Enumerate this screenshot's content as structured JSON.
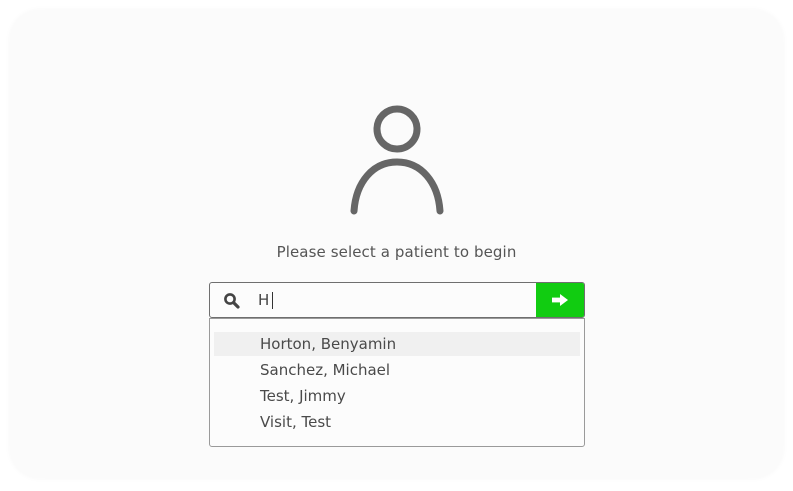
{
  "prompt": "Please select a patient to begin",
  "search": {
    "value": "H",
    "icon": "search-icon"
  },
  "go_button": {
    "icon": "arrow-right-icon",
    "color": "#11cc11"
  },
  "avatar": {
    "icon": "person-icon",
    "color": "#666666"
  },
  "dropdown": {
    "options": [
      {
        "label": "Horton, Benyamin",
        "highlighted": true
      },
      {
        "label": "Sanchez, Michael",
        "highlighted": false
      },
      {
        "label": "Test, Jimmy",
        "highlighted": false
      },
      {
        "label": "Visit, Test",
        "highlighted": false
      }
    ]
  }
}
